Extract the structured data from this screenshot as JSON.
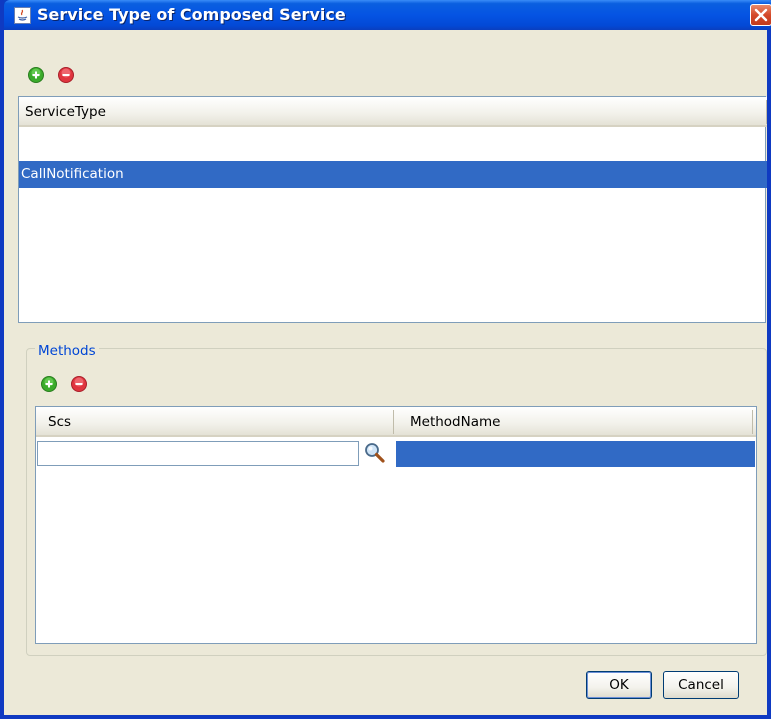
{
  "window": {
    "title": "Service Type of Composed Service",
    "close_label": "Close"
  },
  "service_type_toolbar": {
    "add_icon": "add-icon",
    "remove_icon": "remove-icon"
  },
  "service_type_table": {
    "column_header": "ServiceType",
    "rows": [
      "CallNotification"
    ],
    "selected_row": "CallNotification"
  },
  "methods": {
    "legend": "Methods",
    "toolbar": {
      "add_icon": "add-icon",
      "remove_icon": "remove-icon"
    },
    "columns": [
      "Scs",
      "MethodName"
    ],
    "rows": [
      {
        "scs": "",
        "method_name": ""
      }
    ]
  },
  "buttons": {
    "ok_label": "OK",
    "cancel_label": "Cancel"
  },
  "colors": {
    "selection": "#316ac5",
    "title_bar": "#0554e3",
    "dialog_bg": "#ece9d8",
    "legend_text": "#0046d5",
    "add_green": "#3bab2b",
    "remove_red": "#e0353f"
  }
}
